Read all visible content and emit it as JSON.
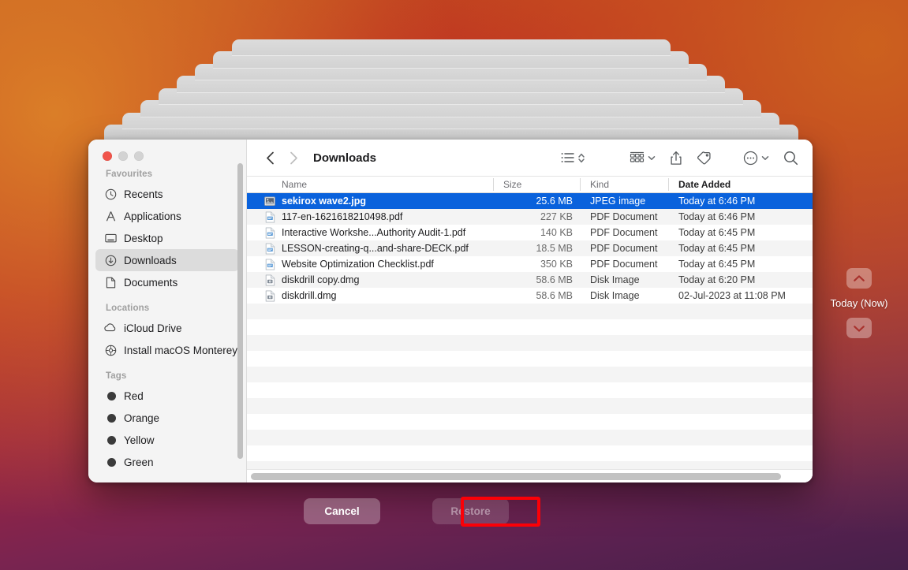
{
  "window": {
    "title": "Downloads",
    "traffic_lights": [
      "close",
      "minimize",
      "maximize"
    ]
  },
  "toolbar": {
    "back_icon": "chevron-left-icon",
    "forward_icon": "chevron-right-icon",
    "view_list_icon": "list-view-icon",
    "sort_icon": "sort-chevrons-icon",
    "group_icon": "group-by-icon",
    "share_icon": "share-icon",
    "tag_icon": "tag-icon",
    "more_icon": "more-ellipsis-icon",
    "search_icon": "search-icon"
  },
  "sidebar": {
    "groups": [
      {
        "title": "Favourites",
        "items": [
          {
            "label": "Recents",
            "icon": "clock-icon",
            "selected": false
          },
          {
            "label": "Applications",
            "icon": "applications-icon",
            "selected": false
          },
          {
            "label": "Desktop",
            "icon": "desktop-icon",
            "selected": false
          },
          {
            "label": "Downloads",
            "icon": "downloads-icon",
            "selected": true
          },
          {
            "label": "Documents",
            "icon": "document-icon",
            "selected": false
          }
        ]
      },
      {
        "title": "Locations",
        "items": [
          {
            "label": "iCloud Drive",
            "icon": "cloud-icon",
            "selected": false
          },
          {
            "label": "Install macOS Monterey",
            "icon": "disk-icon",
            "selected": false
          }
        ]
      },
      {
        "title": "Tags",
        "items": [
          {
            "label": "Red",
            "icon": "tag-dot-icon",
            "selected": false
          },
          {
            "label": "Orange",
            "icon": "tag-dot-icon",
            "selected": false
          },
          {
            "label": "Yellow",
            "icon": "tag-dot-icon",
            "selected": false
          },
          {
            "label": "Green",
            "icon": "tag-dot-icon",
            "selected": false
          }
        ]
      }
    ]
  },
  "file_list": {
    "columns": [
      "Name",
      "Size",
      "Kind",
      "Date Added"
    ],
    "sort_column": "Date Added",
    "rows": [
      {
        "name": "sekirox wave2.jpg",
        "size": "25.6 MB",
        "kind": "JPEG image",
        "date": "Today at 6:46 PM",
        "icon": "image-file-icon",
        "selected": true
      },
      {
        "name": "117-en-1621618210498.pdf",
        "size": "227 KB",
        "kind": "PDF Document",
        "date": "Today at 6:46 PM",
        "icon": "pdf-file-icon",
        "selected": false
      },
      {
        "name": "Interactive Workshe...Authority Audit-1.pdf",
        "size": "140 KB",
        "kind": "PDF Document",
        "date": "Today at 6:45 PM",
        "icon": "pdf-file-icon",
        "selected": false
      },
      {
        "name": "LESSON-creating-q...and-share-DECK.pdf",
        "size": "18.5 MB",
        "kind": "PDF Document",
        "date": "Today at 6:45 PM",
        "icon": "pdf-file-icon",
        "selected": false
      },
      {
        "name": "Website Optimization Checklist.pdf",
        "size": "350 KB",
        "kind": "PDF Document",
        "date": "Today at 6:45 PM",
        "icon": "pdf-file-icon",
        "selected": false
      },
      {
        "name": "diskdrill copy.dmg",
        "size": "58.6 MB",
        "kind": "Disk Image",
        "date": "Today at 6:20 PM",
        "icon": "dmg-file-icon",
        "selected": false
      },
      {
        "name": "diskdrill.dmg",
        "size": "58.6 MB",
        "kind": "Disk Image",
        "date": "02-Jul-2023 at 11:08 PM",
        "icon": "dmg-file-icon",
        "selected": false
      }
    ]
  },
  "timeline": {
    "up_icon": "chevron-up-icon",
    "label": "Today (Now)",
    "down_icon": "chevron-down-icon"
  },
  "actions": {
    "cancel_label": "Cancel",
    "restore_label": "Restore",
    "restore_enabled": false,
    "highlight_color": "#fb0007"
  }
}
